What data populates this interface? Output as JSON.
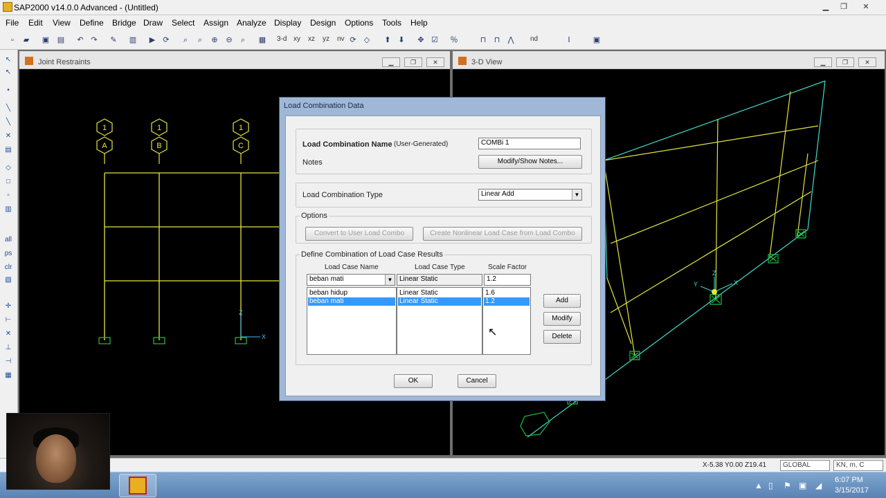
{
  "window": {
    "title": "SAP2000 v14.0.0 Advanced  - (Untitled)",
    "min": "▁",
    "max": "❐",
    "close": "✕"
  },
  "menu": [
    "File",
    "Edit",
    "View",
    "Define",
    "Bridge",
    "Draw",
    "Select",
    "Assign",
    "Analyze",
    "Display",
    "Design",
    "Options",
    "Tools",
    "Help"
  ],
  "toolbar": {
    "view_3d": "3-d",
    "view_xy": "xy",
    "view_xz": "xz",
    "view_yz": "yz",
    "view_nv": "nv",
    "nd": "nd"
  },
  "left_toolbar": {
    "all": "all",
    "ps": "ps",
    "clr": "clr"
  },
  "windows": {
    "left": {
      "title": "Joint Restraints"
    },
    "right": {
      "title": "3-D View"
    }
  },
  "drawing": {
    "grid_top": [
      "1",
      "1",
      "1"
    ],
    "grid_bottom": [
      "A",
      "B",
      "C"
    ],
    "axis_z": "Z",
    "axis_x": "X",
    "axis_y": "Y"
  },
  "dialog": {
    "title": "Load Combination Data",
    "combo_name_label": "Load Combination Name",
    "combo_name_note": "(User-Generated)",
    "combo_name_value": "COMBi 1",
    "notes_label": "Notes",
    "notes_button": "Modify/Show Notes...",
    "type_label": "Load Combination Type",
    "type_value": "Linear Add",
    "options_label": "Options",
    "convert_button": "Convert to User Load Combo",
    "create_button": "Create Nonlinear Load Case from Load Combo",
    "define_label": "Define Combination of Load Case Results",
    "col_case_name": "Load Case Name",
    "col_case_type": "Load Case Type",
    "col_scale": "Scale Factor",
    "input_case_name": "beban mati",
    "input_case_type": "Linear Static",
    "input_scale": "1.2",
    "rows": [
      {
        "name": "beban hidup",
        "type": "Linear Static",
        "scale": "1.6",
        "selected": false
      },
      {
        "name": "beban mati",
        "type": "Linear Static",
        "scale": "1.2",
        "selected": true
      }
    ],
    "add_button": "Add",
    "modify_button": "Modify",
    "delete_button": "Delete",
    "ok_button": "OK",
    "cancel_button": "Cancel"
  },
  "status": {
    "coords": "X-5.38  Y0.00  Z19.41",
    "coord_system": "GLOBAL",
    "units": "KN, m, C"
  },
  "taskbar": {
    "time": "6:07 PM",
    "date": "3/15/2017"
  },
  "colors": {
    "frame_yellow": "#e6e640",
    "frame_cyan": "#40e0d0",
    "restraint_green": "#20c040",
    "selection_blue": "#3399ff"
  }
}
